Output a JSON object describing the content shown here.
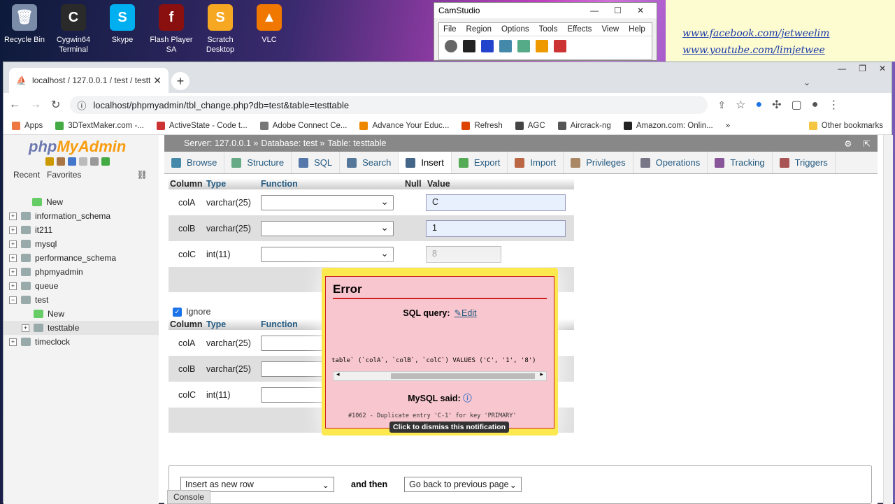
{
  "desktop": {
    "icons": [
      {
        "label": "Recycle Bin",
        "color": "#7a8ca8",
        "glyph": "🗑"
      },
      {
        "label": "Cygwin64 Terminal",
        "color": "#2a2a2a",
        "glyph": "C"
      },
      {
        "label": "Skype",
        "color": "#00aff0",
        "glyph": "S"
      },
      {
        "label": "Flash Player SA",
        "color": "#8a1010",
        "glyph": "f"
      },
      {
        "label": "Scratch Desktop",
        "color": "#f7a823",
        "glyph": "S"
      },
      {
        "label": "VLC",
        "color": "#f07800",
        "glyph": "▲"
      }
    ]
  },
  "links": [
    "www.facebook.com/jetweelim",
    "www.youtube.com/limjetwee"
  ],
  "camstudio": {
    "title": "CamStudio",
    "menu": [
      "File",
      "Region",
      "Options",
      "Tools",
      "Effects",
      "View",
      "Help"
    ]
  },
  "browser": {
    "tab_title": "localhost / 127.0.0.1 / test / testt",
    "url": "localhost/phpmyadmin/tbl_change.php?db=test&table=testtable",
    "bookmarks": [
      "Apps",
      "3DTextMaker.com -...",
      "ActiveState - Code t...",
      "Adobe Connect Ce...",
      "Advance Your Educ...",
      "Refresh",
      "AGC",
      "Aircrack-ng",
      "Amazon.com: Onlin..."
    ],
    "bookmark_colors": [
      "#e74",
      "#4a4",
      "#c33",
      "#777",
      "#e80",
      "#d40",
      "#444",
      "#555",
      "#222"
    ],
    "other_bookmarks": "Other bookmarks"
  },
  "pma": {
    "logo_php": "php",
    "logo_my": "MyAdmin",
    "recent": "Recent",
    "favorites": "Favorites",
    "tree": [
      {
        "label": "New",
        "level": 1,
        "toggle": ""
      },
      {
        "label": "information_schema",
        "level": 0,
        "toggle": "+"
      },
      {
        "label": "it211",
        "level": 0,
        "toggle": "+"
      },
      {
        "label": "mysql",
        "level": 0,
        "toggle": "+"
      },
      {
        "label": "performance_schema",
        "level": 0,
        "toggle": "+"
      },
      {
        "label": "phpmyadmin",
        "level": 0,
        "toggle": "+"
      },
      {
        "label": "queue",
        "level": 0,
        "toggle": "+"
      },
      {
        "label": "test",
        "level": 0,
        "toggle": "−"
      },
      {
        "label": "New",
        "level": 2,
        "toggle": ""
      },
      {
        "label": "testtable",
        "level": 2,
        "toggle": "+"
      },
      {
        "label": "timeclock",
        "level": 0,
        "toggle": "+"
      }
    ],
    "breadcrumb": [
      "Server: 127.0.0.1 »",
      "Database: test »",
      "Table: testtable"
    ],
    "tabs": [
      "Browse",
      "Structure",
      "SQL",
      "Search",
      "Insert",
      "Export",
      "Import",
      "Privileges",
      "Operations",
      "Tracking",
      "Triggers"
    ],
    "active_tab": "Insert",
    "headers": {
      "column": "Column",
      "type": "Type",
      "function": "Function",
      "null": "Null",
      "value": "Value"
    },
    "rows1": [
      {
        "col": "colA",
        "type": "varchar(25)",
        "value": "C"
      },
      {
        "col": "colB",
        "type": "varchar(25)",
        "value": "1"
      },
      {
        "col": "colC",
        "type": "int(11)",
        "value": "8"
      }
    ],
    "ignore_label": "Ignore",
    "rows2": [
      {
        "col": "colA",
        "type": "varchar(25)"
      },
      {
        "col": "colB",
        "type": "varchar(25)"
      },
      {
        "col": "colC",
        "type": "int(11)"
      }
    ],
    "insert_as": "Insert as new row",
    "and_then": "and then",
    "go_back": "Go back to previous page",
    "console": "Console"
  },
  "error": {
    "title": "Error",
    "sql_query_label": "SQL query:",
    "edit_label": "Edit",
    "sql_text": "table` (`colA`, `colB`, `colC`) VALUES ('C', '1', '8')",
    "mysql_said": "MySQL said:",
    "message": "#1062 - Duplicate entry 'C-1' for key 'PRIMARY'",
    "tooltip": "Click to dismiss this notification"
  }
}
